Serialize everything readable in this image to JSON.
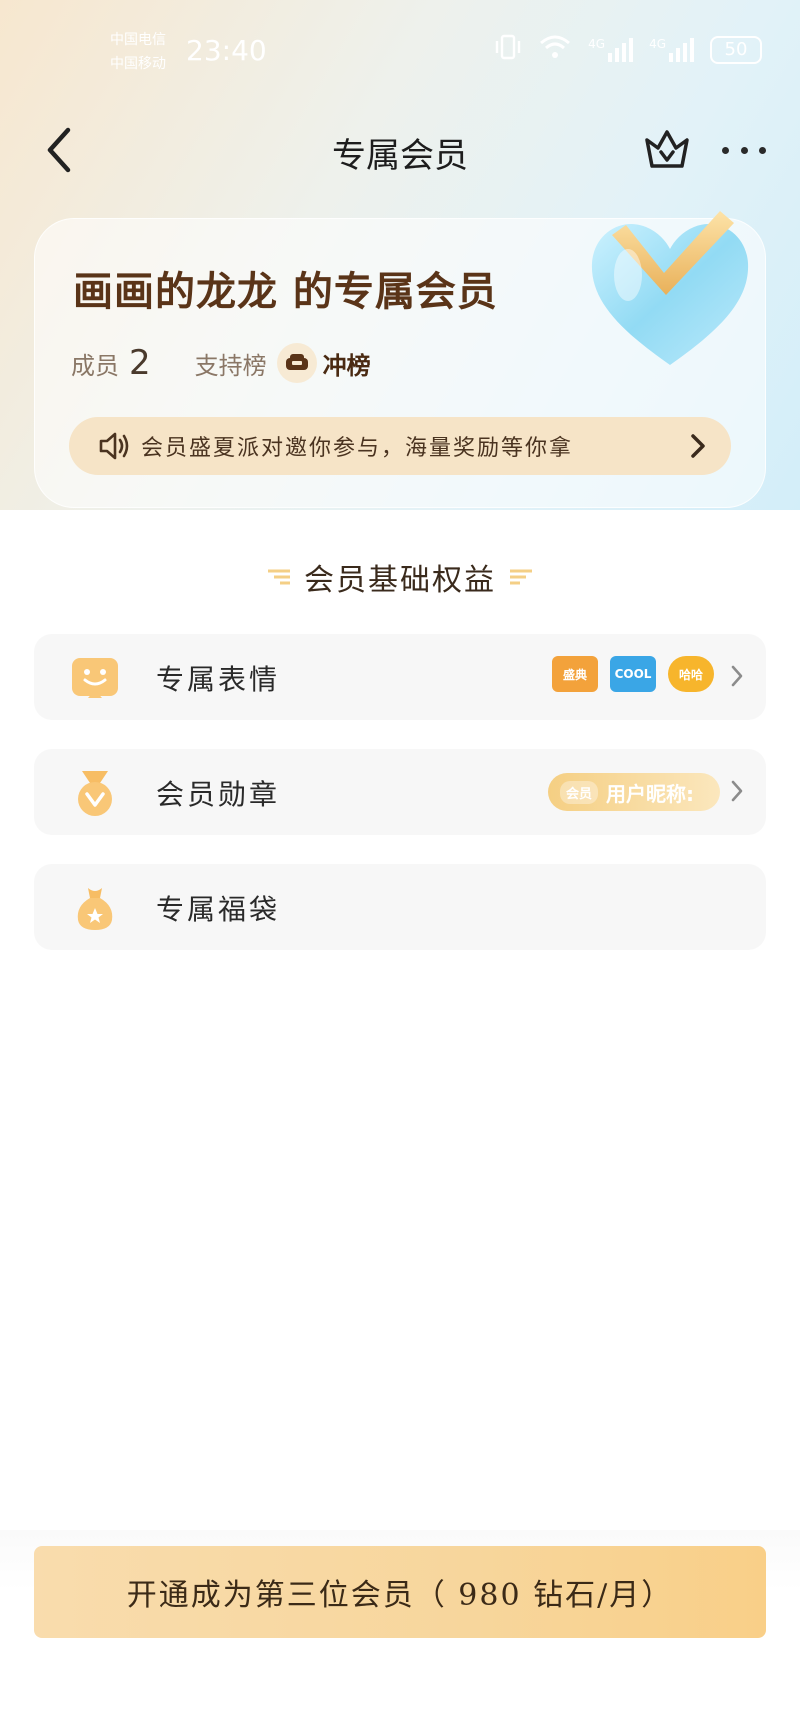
{
  "status_bar": {
    "carrier_1": "中国电信",
    "carrier_2": "中国移动",
    "time": "23:40",
    "network_1": "4G",
    "network_2": "4G",
    "battery": "50"
  },
  "nav": {
    "title": "专属会员",
    "icons": [
      "back-arrow-icon",
      "crown-icon",
      "more-icon"
    ]
  },
  "header": {
    "group_title": "画画的龙龙 的专属会员",
    "members_label": "成员",
    "members_count": "2",
    "support_label": "支持榜",
    "rank_button": "冲榜",
    "banner_text": "会员盛夏派对邀你参与，海量奖励等你拿"
  },
  "section": {
    "title": "会员基础权益"
  },
  "benefits": [
    {
      "label": "专属表情",
      "icon": "smile-badge-icon",
      "stickers": [
        "盛典",
        "COOL",
        "哈哈"
      ]
    },
    {
      "label": "会员勋章",
      "icon": "medal-icon",
      "pill_tag": "会员",
      "pill_text": "用户昵称:"
    },
    {
      "label": "专属福袋",
      "icon": "lucky-bag-icon"
    }
  ],
  "cta": {
    "label": "开通成为第三位会员（ 980 钻石/月）"
  },
  "colors": {
    "accent_gold": "#f7d69c",
    "title_brown": "#5a3418",
    "card_bg": "#f7f7f7"
  }
}
